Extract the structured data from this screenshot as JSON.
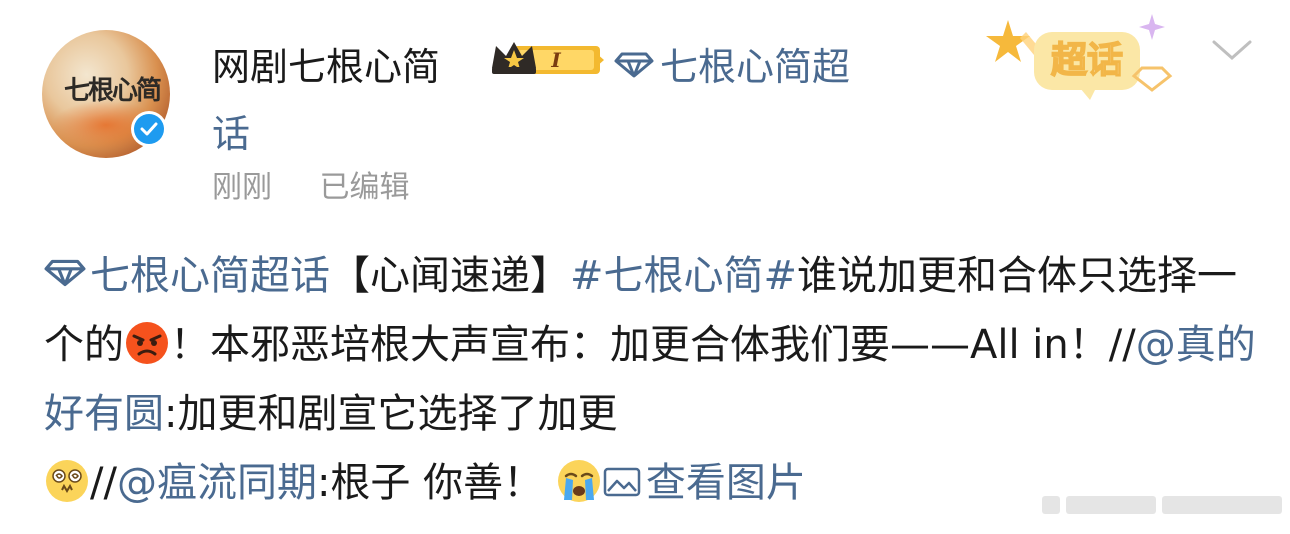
{
  "post": {
    "author": "网剧七根心简",
    "member_level": "I",
    "super_topic_line1": "七根心简超",
    "super_topic_line2": "话",
    "time": "刚刚",
    "edited": "已编辑",
    "badge_label": "超话"
  },
  "body": {
    "topic_link": "七根心简超话",
    "seg1": "【心闻速递】",
    "hashtag": "#七根心简#",
    "seg2": "谁说加更和合体只选择一个的",
    "seg3": "！本邪恶培根大声宣布：加更合体我们要——All in！//",
    "mention1": "@真的好有圆",
    "seg4": ":加更和剧宣它选择了加更",
    "seg5": "//",
    "mention2": "@瘟流同期",
    "seg6": ":根子 你善！",
    "view_images": "查看图片"
  },
  "colors": {
    "link": "#4a6a90",
    "verified": "#1e9bf0",
    "badge": "#f6b93b"
  },
  "icons": {
    "verified": "verified-icon",
    "crown": "crown-icon",
    "diamond": "diamond-icon",
    "chevron": "chevron-down-icon",
    "angry": "angry-face-emoji",
    "dizzy": "dizzy-face-emoji",
    "crying": "crying-face-emoji",
    "image": "image-icon"
  }
}
